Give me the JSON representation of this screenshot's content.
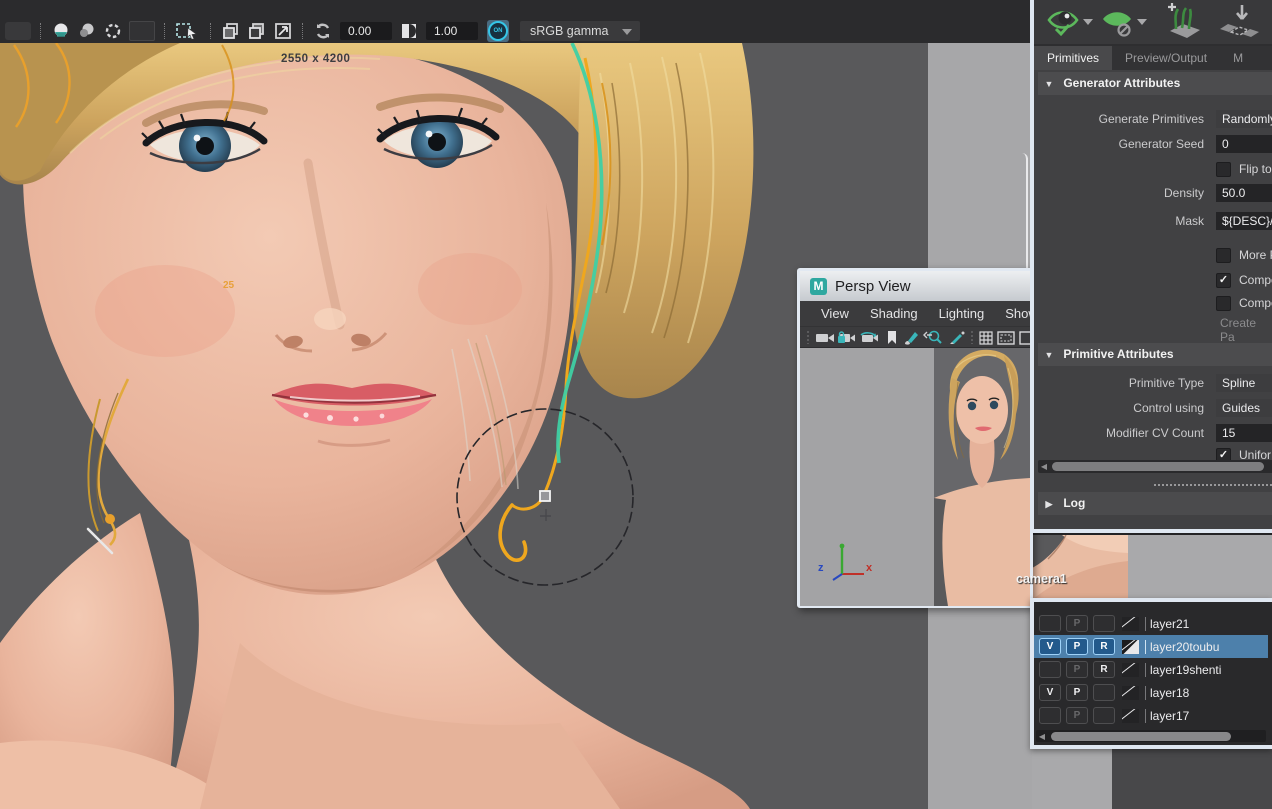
{
  "render_toolbar": {
    "exposure_value": "0.00",
    "gamma_value": "1.00",
    "on_badge": "ON",
    "colorspace_selected": "sRGB gamma",
    "resolution_label": "2550 x 4200"
  },
  "persp_window": {
    "logo": "M",
    "title": "Persp View",
    "menus": [
      {
        "label": "View"
      },
      {
        "label": "Shading"
      },
      {
        "label": "Lighting"
      },
      {
        "label": "Show"
      }
    ],
    "camera_label": "camera1",
    "mini_resolution": "25",
    "axis": {
      "x": "x",
      "z": "z"
    }
  },
  "attr_panel": {
    "tabs": [
      {
        "label": "Primitives",
        "active": true
      },
      {
        "label": "Preview/Output",
        "active": false
      },
      {
        "label": "M",
        "active": false
      }
    ],
    "generator": {
      "title": "Generator Attributes",
      "rows": [
        {
          "label": "Generate Primitives",
          "value": "Randomly",
          "type": "dropdown"
        },
        {
          "label": "Generator Seed",
          "value": "0",
          "type": "input"
        },
        {
          "label": "Density",
          "value": "50.0",
          "type": "input"
        },
        {
          "label": "Mask",
          "value": "${DESC}/p",
          "type": "input"
        }
      ],
      "flip_checkbox": {
        "label": "Flip to",
        "checked": false
      },
      "checkboxes": [
        {
          "label": "More P",
          "checked": false
        },
        {
          "label": "Compe",
          "checked": true
        },
        {
          "label": "Compe",
          "checked": false
        }
      ],
      "create_button": "Create Pa"
    },
    "primitive": {
      "title": "Primitive Attributes",
      "rows": [
        {
          "label": "Primitive Type",
          "value": "Spline",
          "type": "dropdown"
        },
        {
          "label": "Control using",
          "value": "Guides",
          "type": "dropdown"
        },
        {
          "label": "Modifier CV Count",
          "value": "15",
          "type": "input"
        }
      ],
      "uniform_checkbox": {
        "label": "Unifor",
        "checked": true
      }
    },
    "log": {
      "title": "Log"
    }
  },
  "layer_panel": {
    "rows": [
      {
        "v": "",
        "p": "P",
        "r": "",
        "name": "layer21",
        "selected": false
      },
      {
        "v": "V",
        "p": "P",
        "r": "R",
        "name": "layer20toubu",
        "selected": true
      },
      {
        "v": "",
        "p": "P",
        "r": "R",
        "name": "layer19shenti",
        "selected": false
      },
      {
        "v": "V",
        "p": "P",
        "r": "",
        "name": "layer18",
        "selected": false
      },
      {
        "v": "",
        "p": "P",
        "r": "",
        "name": "layer17",
        "selected": false
      }
    ]
  },
  "glyphs": {
    "caret_down": "▼",
    "caret_right": "▶",
    "arrow_left": "◀",
    "check": "✓"
  },
  "colors": {
    "selection_blue": "#4d80ab",
    "guide_yellow": "#efa71e",
    "guide_teal": "#3fd0a4",
    "window_border": "#dfe7f1",
    "maya_teal": "#2fa8a0",
    "viewport_gray": "#59595b"
  }
}
